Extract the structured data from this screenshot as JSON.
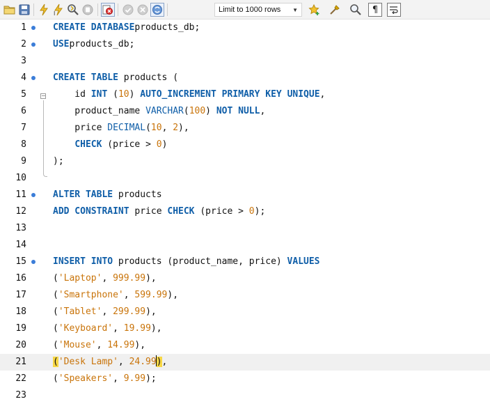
{
  "toolbar": {
    "buttons": [
      {
        "name": "open-folder-icon"
      },
      {
        "name": "save-icon"
      },
      {
        "name": "execute-icon"
      },
      {
        "name": "execute-current-icon"
      },
      {
        "name": "explain-icon"
      },
      {
        "name": "stop-icon"
      },
      {
        "name": "toggle-error-icon"
      },
      {
        "name": "commit-icon"
      },
      {
        "name": "rollback-icon"
      },
      {
        "name": "autocommit-icon"
      },
      {
        "name": "bookmark-icon"
      },
      {
        "name": "beautify-icon"
      },
      {
        "name": "find-icon"
      },
      {
        "name": "invisible-chars-icon"
      },
      {
        "name": "word-wrap-icon"
      }
    ],
    "limit_label": "Limit to 1000 rows"
  },
  "editor": {
    "current_line": 21,
    "lines": [
      {
        "n": "1",
        "dot": true,
        "tokens": [
          [
            "kw",
            "CREATE DATABASE"
          ],
          [
            "",
            "products_db;"
          ]
        ]
      },
      {
        "n": "2",
        "dot": true,
        "tokens": [
          [
            "kw",
            "USE"
          ],
          [
            "",
            "products_db;"
          ]
        ]
      },
      {
        "n": "3",
        "dot": false,
        "tokens": []
      },
      {
        "n": "4",
        "dot": true,
        "tokens": [
          [
            "kw",
            "CREATE TABLE"
          ],
          [
            "",
            " products ("
          ]
        ]
      },
      {
        "n": "5",
        "dot": false,
        "tokens": [
          [
            "",
            "    id "
          ],
          [
            "kw",
            "INT"
          ],
          [
            "",
            " ("
          ],
          [
            "num",
            "10"
          ],
          [
            "",
            ") "
          ],
          [
            "kw",
            "AUTO_INCREMENT PRIMARY KEY UNIQUE"
          ],
          [
            "",
            ","
          ]
        ]
      },
      {
        "n": "6",
        "dot": false,
        "tokens": [
          [
            "",
            "    product_name "
          ],
          [
            "fn",
            "VARCHAR"
          ],
          [
            "",
            "("
          ],
          [
            "num",
            "100"
          ],
          [
            "",
            ") "
          ],
          [
            "kw",
            "NOT NULL"
          ],
          [
            "",
            ","
          ]
        ]
      },
      {
        "n": "7",
        "dot": false,
        "tokens": [
          [
            "",
            "    price "
          ],
          [
            "fn",
            "DECIMAL"
          ],
          [
            "",
            "("
          ],
          [
            "num",
            "10"
          ],
          [
            "",
            ", "
          ],
          [
            "num",
            "2"
          ],
          [
            "",
            "),"
          ]
        ]
      },
      {
        "n": "8",
        "dot": false,
        "tokens": [
          [
            "",
            "    "
          ],
          [
            "kw",
            "CHECK"
          ],
          [
            "",
            " (price > "
          ],
          [
            "num",
            "0"
          ],
          [
            "",
            ")"
          ]
        ]
      },
      {
        "n": "9",
        "dot": false,
        "tokens": [
          [
            "",
            ");"
          ]
        ]
      },
      {
        "n": "10",
        "dot": false,
        "tokens": []
      },
      {
        "n": "11",
        "dot": true,
        "tokens": [
          [
            "kw",
            "ALTER TABLE"
          ],
          [
            "",
            " products"
          ]
        ]
      },
      {
        "n": "12",
        "dot": false,
        "tokens": [
          [
            "kw",
            "ADD CONSTRAINT"
          ],
          [
            "",
            " price "
          ],
          [
            "kw",
            "CHECK"
          ],
          [
            "",
            " (price > "
          ],
          [
            "num",
            "0"
          ],
          [
            "",
            ");"
          ]
        ]
      },
      {
        "n": "13",
        "dot": false,
        "tokens": []
      },
      {
        "n": "14",
        "dot": false,
        "tokens": []
      },
      {
        "n": "15",
        "dot": true,
        "tokens": [
          [
            "kw",
            "INSERT INTO"
          ],
          [
            "",
            " products (product_name, price) "
          ],
          [
            "kw",
            "VALUES"
          ]
        ]
      },
      {
        "n": "16",
        "dot": false,
        "tokens": [
          [
            "",
            "("
          ],
          [
            "str",
            "'Laptop'"
          ],
          [
            "",
            ", "
          ],
          [
            "num",
            "999.99"
          ],
          [
            "",
            "),"
          ]
        ]
      },
      {
        "n": "17",
        "dot": false,
        "tokens": [
          [
            "",
            "("
          ],
          [
            "str",
            "'Smartphone'"
          ],
          [
            "",
            ", "
          ],
          [
            "num",
            "599.99"
          ],
          [
            "",
            "),"
          ]
        ]
      },
      {
        "n": "18",
        "dot": false,
        "tokens": [
          [
            "",
            "("
          ],
          [
            "str",
            "'Tablet'"
          ],
          [
            "",
            ", "
          ],
          [
            "num",
            "299.99"
          ],
          [
            "",
            "),"
          ]
        ]
      },
      {
        "n": "19",
        "dot": false,
        "tokens": [
          [
            "",
            "("
          ],
          [
            "str",
            "'Keyboard'"
          ],
          [
            "",
            ", "
          ],
          [
            "num",
            "19.99"
          ],
          [
            "",
            "),"
          ]
        ]
      },
      {
        "n": "20",
        "dot": false,
        "tokens": [
          [
            "",
            "("
          ],
          [
            "str",
            "'Mouse'"
          ],
          [
            "",
            ", "
          ],
          [
            "num",
            "14.99"
          ],
          [
            "",
            "),"
          ]
        ]
      },
      {
        "n": "21",
        "dot": false,
        "tokens": [
          [
            "hl",
            "("
          ],
          [
            "str",
            "'Desk Lamp'"
          ],
          [
            "",
            ", "
          ],
          [
            "num",
            "24.99"
          ],
          [
            "caret",
            ""
          ],
          [
            "hl",
            ")"
          ],
          [
            "",
            ","
          ]
        ]
      },
      {
        "n": "22",
        "dot": false,
        "tokens": [
          [
            "",
            "("
          ],
          [
            "str",
            "'Speakers'"
          ],
          [
            "",
            ", "
          ],
          [
            "num",
            "9.99"
          ],
          [
            "",
            ");"
          ]
        ]
      },
      {
        "n": "23",
        "dot": false,
        "tokens": []
      }
    ]
  }
}
